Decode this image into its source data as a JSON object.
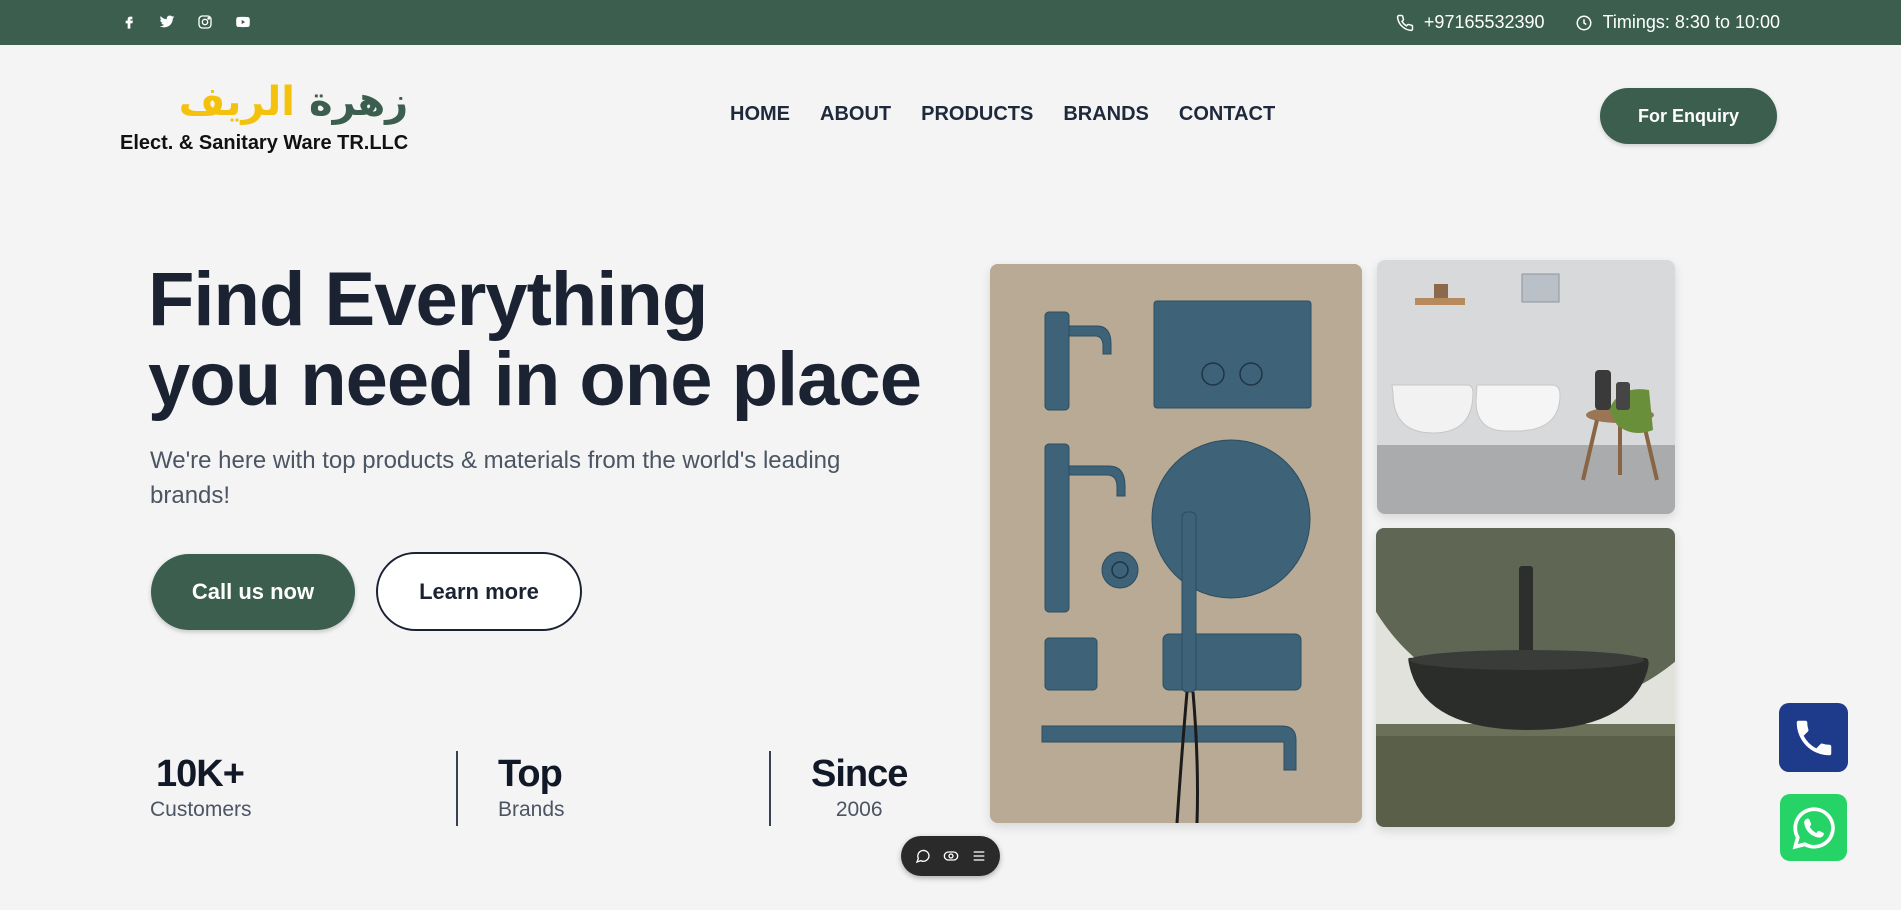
{
  "topbar": {
    "social_icons": [
      "facebook-icon",
      "twitter-icon",
      "instagram-icon",
      "youtube-icon"
    ],
    "phone": "+97165532390",
    "timings": "Timings: 8:30 to 10:00"
  },
  "logo": {
    "arabic_green": "زهرة",
    "arabic_yellow": "الريف",
    "english": "Elect. & Sanitary Ware TR.LLC"
  },
  "nav": {
    "items": [
      "HOME",
      "ABOUT",
      "PRODUCTS",
      "BRANDS",
      "CONTACT"
    ]
  },
  "header": {
    "enquiry_label": "For Enquiry"
  },
  "hero": {
    "title_line1": "Find Everything",
    "title_line2": "you need in one place",
    "subtitle": "We're here with top products & materials from the world's leading brands!",
    "call_label": "Call us now",
    "learn_label": "Learn more"
  },
  "stats": [
    {
      "value": "10K+",
      "label": "Customers"
    },
    {
      "value": "Top",
      "label": "Brands"
    },
    {
      "value": "Since",
      "label": "2006"
    }
  ],
  "colors": {
    "brand_green": "#3b5e4f",
    "logo_yellow": "#f4c20d",
    "phone_float": "#1e3a8a",
    "whatsapp_float": "#25d366"
  },
  "floating": {
    "icons": [
      "phone-icon",
      "whatsapp-icon"
    ]
  },
  "toolbar": {
    "icons": [
      "comment-icon",
      "eye-icon",
      "menu-icon"
    ]
  }
}
